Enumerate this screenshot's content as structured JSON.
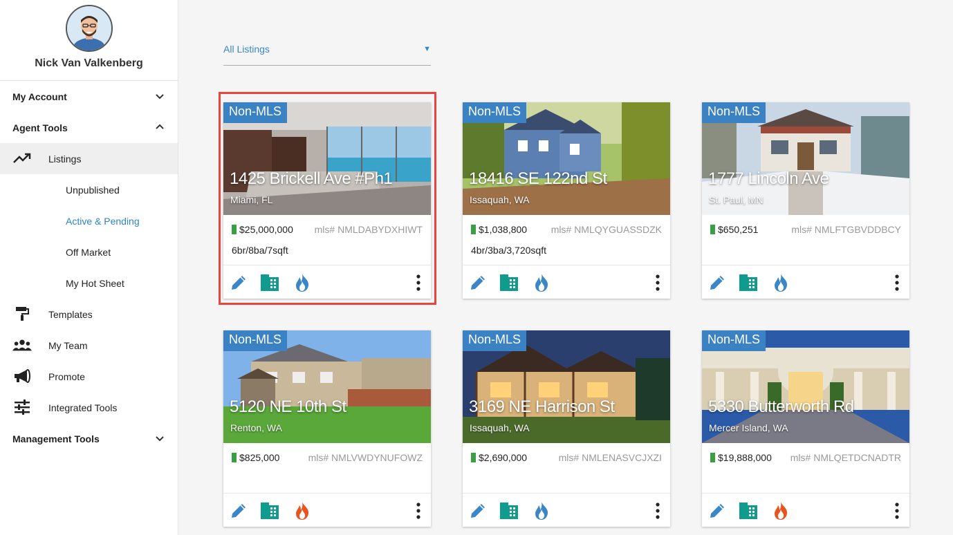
{
  "profile": {
    "name": "Nick Van Valkenberg"
  },
  "nav": {
    "my_account": "My Account",
    "agent_tools": "Agent Tools",
    "listings": "Listings",
    "unpublished": "Unpublished",
    "active_pending": "Active & Pending",
    "off_market": "Off Market",
    "my_hot_sheet": "My Hot Sheet",
    "templates": "Templates",
    "my_team": "My Team",
    "promote": "Promote",
    "integrated_tools": "Integrated Tools",
    "management_tools": "Management Tools"
  },
  "filter": {
    "value": "All Listings",
    "arrow": "▼"
  },
  "colors": {
    "accent": "#3b82c4",
    "selected": "#e8453c",
    "price_mark": "#38a043",
    "hot_active": "#e8531f",
    "hot_inactive": "#3a87c8",
    "flyer": "#0f9b8e"
  },
  "listings": [
    {
      "badge": "Non-MLS",
      "address": "1425 Brickell Ave #Ph1",
      "city": "Miami, FL",
      "price": "$25,000,000",
      "mls": "mls# NMLDABYDXHIWT",
      "specs": "6br/8ba/7sqft",
      "hot": false,
      "selected": true
    },
    {
      "badge": "Non-MLS",
      "address": "18416 SE 122nd St",
      "city": "Issaquah, WA",
      "price": "$1,038,800",
      "mls": "mls# NMLQYGUASSDZK",
      "specs": "4br/3ba/3,720sqft",
      "hot": false,
      "selected": false
    },
    {
      "badge": "Non-MLS",
      "address": "1777 Lincoln Ave",
      "city": "St. Paul, MN",
      "price": "$650,251",
      "mls": "mls# NMLFTGBVDDBCY",
      "specs": "",
      "hot": false,
      "selected": false
    },
    {
      "badge": "Non-MLS",
      "address": "5120 NE 10th St",
      "city": "Renton, WA",
      "price": "$825,000",
      "mls": "mls# NMLVWDYNUFOWZ",
      "specs": "",
      "hot": true,
      "selected": false
    },
    {
      "badge": "Non-MLS",
      "address": "3169 NE Harrison St",
      "city": "Issaquah, WA",
      "price": "$2,690,000",
      "mls": "mls# NMLENASVCJXZI",
      "specs": "",
      "hot": false,
      "selected": false
    },
    {
      "badge": "Non-MLS",
      "address": "5330 Butterworth Rd",
      "city": "Mercer Island, WA",
      "price": "$19,888,000",
      "mls": "mls# NMLQETDCNADTR",
      "specs": "",
      "hot": true,
      "selected": false
    }
  ]
}
